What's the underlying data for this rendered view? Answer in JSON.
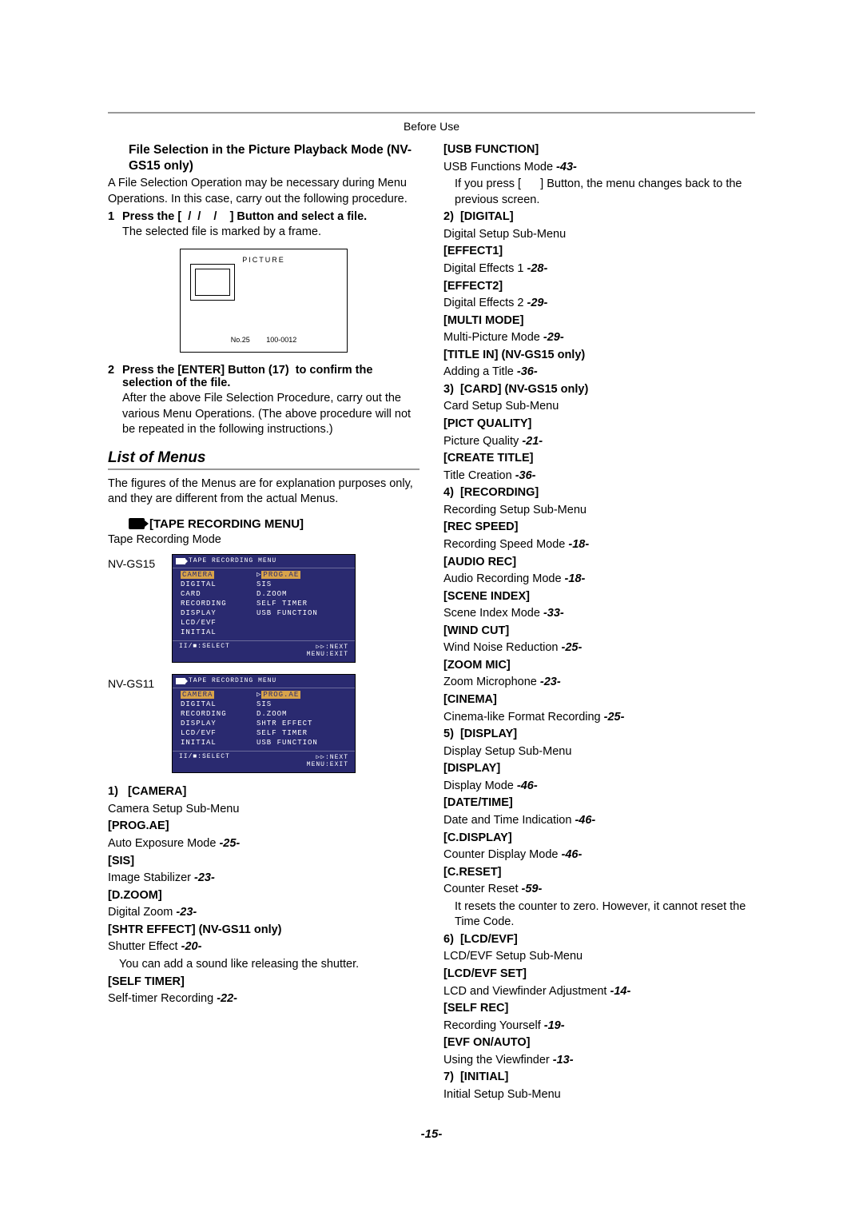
{
  "header": "Before Use",
  "pageNumber": "-15-",
  "left": {
    "title": "File Selection in the Picture Playback Mode (NV-GS15 only)",
    "intro": "A File Selection Operation may be necessary during Menu Operations. In this case, carry out the following procedure.",
    "step1_num": "1",
    "step1_text": "Press the [  /  /    /    ] Button and select a file.",
    "step1_after": "The selected file is marked by a frame.",
    "picture_label": "PICTURE",
    "picture_meta": "No.25 100-0012",
    "step2_num": "2",
    "step2_text": "Press the [ENTER] Button (17)  to confirm the selection of the file.",
    "step2_after": "After the above File Selection Procedure, carry out the various Menu Operations. (The above procedure will not be repeated in the following instructions.)",
    "list_header": "List of Menus",
    "list_intro": "The figures of the Menus are for explanation purposes only, and they are different from the actual Menus.",
    "tape_menu_title": "[TAPE RECORDING MENU]",
    "tape_mode": "Tape Recording Mode",
    "model1": "NV-GS15",
    "model2": "NV-GS11",
    "menu_title_text": "TAPE RECORDING MENU",
    "gs15_rows": [
      [
        "CAMERA",
        "PROG.AE"
      ],
      [
        "DIGITAL",
        "SIS"
      ],
      [
        "CARD",
        "D.ZOOM"
      ],
      [
        "RECORDING",
        "SELF TIMER"
      ],
      [
        "DISPLAY",
        "USB FUNCTION"
      ],
      [
        "LCD/EVF",
        ""
      ],
      [
        "INITIAL",
        ""
      ]
    ],
    "gs11_rows": [
      [
        "CAMERA",
        "PROG.AE"
      ],
      [
        "DIGITAL",
        "SIS"
      ],
      [
        "RECORDING",
        "D.ZOOM"
      ],
      [
        "DISPLAY",
        "SHTR EFFECT"
      ],
      [
        "LCD/EVF",
        "SELF TIMER"
      ],
      [
        "INITIAL",
        "USB FUNCTION"
      ]
    ],
    "footer_select": "II/■:SELECT",
    "footer_next": "▷▷:NEXT",
    "footer_exit": "MENU:EXIT",
    "cam_num": "1)",
    "cam_head": "[CAMERA]",
    "cam_sub": "Camera Setup Sub-Menu",
    "items": [
      {
        "b": "[PROG.AE]",
        "t": "Auto Exposure Mode ",
        "r": "-25-"
      },
      {
        "b": "[SIS]",
        "t": "Image Stabilizer ",
        "r": "-23-"
      },
      {
        "b": "[D.ZOOM]",
        "t": "Digital Zoom ",
        "r": "-23-"
      },
      {
        "b": "[SHTR EFFECT] (NV-GS11 only)",
        "t": "Shutter Effect ",
        "r": "-20-"
      }
    ],
    "shtr_note": "You can add a sound like releasing the shutter.",
    "selftimer_b": "[SELF TIMER]",
    "selftimer_t": "Self-timer Recording ",
    "selftimer_r": "-22-"
  },
  "right": {
    "usbfunc_b": "[USB FUNCTION]",
    "usbfunc_t": "USB Functions Mode ",
    "usbfunc_r": "-43-",
    "usbfunc_note": "If you press [      ] Button, the menu changes back to the previous screen.",
    "sections": [
      {
        "num": "2)",
        "head": "[DIGITAL]",
        "sub": "Digital Setup Sub-Menu",
        "items": [
          {
            "b": "[EFFECT1]",
            "t": "Digital Effects 1 ",
            "r": "-28-"
          },
          {
            "b": "[EFFECT2]",
            "t": "Digital Effects 2 ",
            "r": "-29-"
          },
          {
            "b": "[MULTI MODE]",
            "t": "Multi-Picture Mode ",
            "r": "-29-"
          },
          {
            "b": "[TITLE IN] (NV-GS15 only)",
            "t": "Adding a Title ",
            "r": "-36-"
          }
        ]
      },
      {
        "num": "3)",
        "head": "[CARD] (NV-GS15 only)",
        "sub": "Card Setup Sub-Menu",
        "items": [
          {
            "b": "[PICT QUALITY]",
            "t": "Picture Quality ",
            "r": "-21-"
          },
          {
            "b": "[CREATE TITLE]",
            "t": "Title Creation ",
            "r": "-36-"
          }
        ]
      },
      {
        "num": "4)",
        "head": "[RECORDING]",
        "sub": "Recording Setup Sub-Menu",
        "items": [
          {
            "b": "[REC SPEED]",
            "t": "Recording Speed Mode ",
            "r": "-18-"
          },
          {
            "b": "[AUDIO REC]",
            "t": "Audio Recording Mode ",
            "r": "-18-"
          },
          {
            "b": "[SCENE INDEX]",
            "t": "Scene Index Mode ",
            "r": "-33-"
          },
          {
            "b": "[WIND CUT]",
            "t": "Wind Noise Reduction ",
            "r": "-25-"
          },
          {
            "b": "[ZOOM MIC]",
            "t": "Zoom Microphone ",
            "r": "-23-"
          },
          {
            "b": "[CINEMA]",
            "t": "Cinema-like Format Recording ",
            "r": "-25-"
          }
        ]
      },
      {
        "num": "5)",
        "head": "[DISPLAY]",
        "sub": "Display Setup Sub-Menu",
        "items": [
          {
            "b": "[DISPLAY]",
            "t": "Display Mode ",
            "r": "-46-"
          },
          {
            "b": "[DATE/TIME]",
            "t": "Date and Time Indication ",
            "r": "-46-"
          },
          {
            "b": "[C.DISPLAY]",
            "t": "Counter Display Mode ",
            "r": "-46-"
          },
          {
            "b": "[C.RESET]",
            "t": "Counter Reset ",
            "r": "-59-",
            "note": "It resets the counter to zero. However, it cannot reset the Time Code."
          }
        ]
      },
      {
        "num": "6)",
        "head": "[LCD/EVF]",
        "sub": "LCD/EVF Setup Sub-Menu",
        "items": [
          {
            "b": "[LCD/EVF SET]",
            "t": "LCD and Viewfinder Adjustment ",
            "r": "-14-"
          },
          {
            "b": "[SELF REC]",
            "t": "Recording Yourself ",
            "r": "-19-"
          },
          {
            "b": "[EVF ON/AUTO]",
            "t": "Using the Viewfinder ",
            "r": "-13-"
          }
        ]
      },
      {
        "num": "7)",
        "head": "[INITIAL]",
        "sub": "Initial Setup Sub-Menu",
        "items": []
      }
    ]
  }
}
